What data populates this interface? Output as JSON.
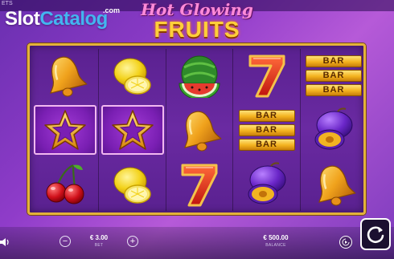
{
  "top_strip": {
    "text": "ETS"
  },
  "site_logo": {
    "word1": "Slot",
    "word2": "Catalog",
    "suffix": ".com"
  },
  "game_logo": {
    "line1": "Hot Glowing",
    "line2": "FRUITS"
  },
  "reels": [
    [
      "bell",
      "star",
      "cherry"
    ],
    [
      "lemon",
      "star",
      "lemon"
    ],
    [
      "watermelon",
      "bell",
      "seven"
    ],
    [
      "seven",
      "bar3",
      "plum"
    ],
    [
      "bar3",
      "plum",
      "bell"
    ]
  ],
  "bar_label": "BAR",
  "controls": {
    "bet_value": "€ 3.00",
    "bet_caption": "BET",
    "balance_value": "€ 500.00",
    "balance_caption": "BALANCE",
    "minus_label": "−",
    "plus_label": "+"
  },
  "colors": {
    "frame_gold": "#e3b23a",
    "bg_purple": "#8f3cc9",
    "logo_blue": "#43b5f0",
    "title_pink": "#ff8bd8",
    "title_gold": "#ffcf3a"
  }
}
